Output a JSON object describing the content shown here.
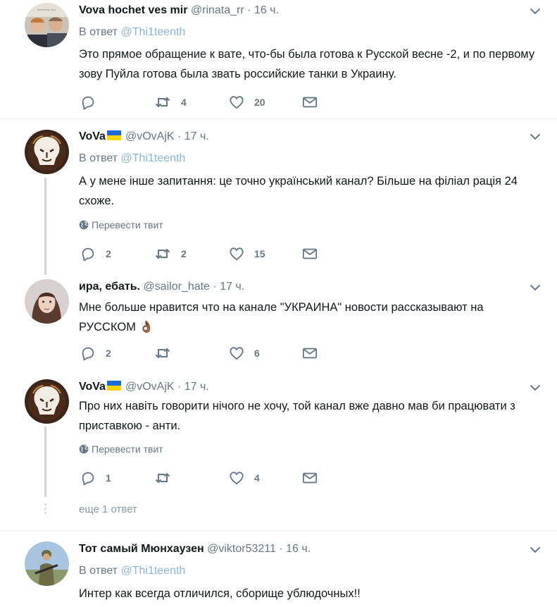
{
  "tweets": [
    {
      "name": "Vova hochet ves mir",
      "handle": "@rinata_rr",
      "dot": "·",
      "time": "16 ч.",
      "reply_prefix": "В ответ",
      "reply_to": "@Thi1teenth",
      "text": "Это прямое обращение к вате, что-бы была готова к Русской весне -2, и по первому зову Пуйла готова была звать российские танки в Украину.",
      "replies": "",
      "retweets": "4",
      "likes": "20",
      "avatar": "two-men-photo"
    },
    {
      "name": "VoVa",
      "handle": "@vOvAjK",
      "dot": "·",
      "time": "17 ч.",
      "reply_prefix": "В ответ",
      "reply_to": "@Thi1teenth",
      "text": "А у мене інше запитання: це точно український канал? Більше на філіал рація 24 схоже.",
      "translate": "Перевести твит",
      "replies": "2",
      "retweets": "2",
      "likes": "15",
      "avatar": "lion-logo"
    },
    {
      "name": "ира, ебать.",
      "handle": "@sailor_hate",
      "dot": "·",
      "time": "17 ч.",
      "text": "Мне больше нравится что на канале \"УКРАИНА\" новости рассказывают на РУССКОМ",
      "emoji": "👌🏾",
      "replies": "2",
      "retweets": "",
      "likes": "6",
      "avatar": "girl-photo"
    },
    {
      "name": "VoVa",
      "handle": "@vOvAjK",
      "dot": "·",
      "time": "17 ч.",
      "text": "Про них навіть говорити нічого не хочу, той канал вже давно мав би працювати з приставкою - анти.",
      "translate": "Перевести твит",
      "replies": "1",
      "retweets": "",
      "likes": "4",
      "avatar": "lion-logo"
    },
    {
      "name": "Тот самый Мюнхаузен",
      "handle": "@viktor53211",
      "dot": "·",
      "time": "16 ч.",
      "reply_prefix": "В ответ",
      "reply_to": "@Thi1teenth",
      "text": "Интер как всегда отличился, сборище ублюдочных!!",
      "avatar": "soldier-photo"
    }
  ],
  "more_replies": "еще 1 ответ",
  "colors": {
    "text": "#14171a",
    "muted": "#657786",
    "link": "#8ab4d9",
    "divider": "#e6ecf0",
    "thread": "#ccd6dd"
  },
  "icons": [
    "reply-icon",
    "retweet-icon",
    "like-icon",
    "message-icon",
    "globe-icon",
    "chevron-down-icon",
    "ukraine-flag-icon"
  ]
}
